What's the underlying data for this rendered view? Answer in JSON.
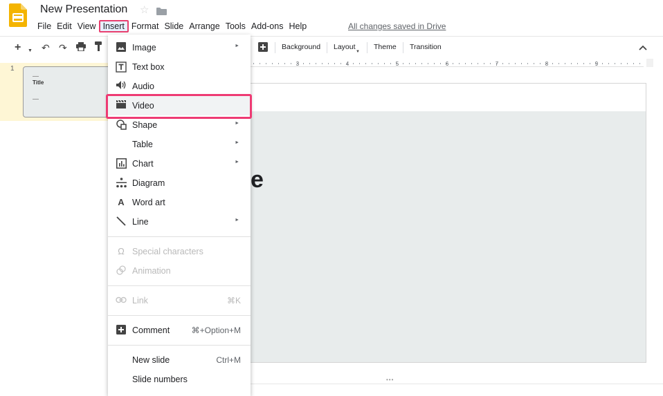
{
  "header": {
    "title": "New Presentation",
    "saved_status": "All changes saved in Drive",
    "accent": "#f4b400"
  },
  "menubar": {
    "items": [
      "File",
      "Edit",
      "View",
      "Insert",
      "Format",
      "Slide",
      "Arrange",
      "Tools",
      "Add-ons",
      "Help"
    ],
    "active": "Insert"
  },
  "toolbar": {
    "background_label": "Background",
    "layout_label": "Layout",
    "theme_label": "Theme",
    "transition_label": "Transition"
  },
  "ruler": {
    "marks": [
      "3",
      "4",
      "5",
      "6",
      "7",
      "8",
      "9"
    ]
  },
  "filmstrip": {
    "slide_number": "1",
    "thumb_title": "Title"
  },
  "canvas": {
    "partial_text": "e"
  },
  "insert_menu": {
    "items": [
      {
        "label": "Image",
        "icon": "image-icon",
        "submenu": true,
        "enabled": true
      },
      {
        "label": "Text box",
        "icon": "text-box-icon",
        "submenu": false,
        "enabled": true
      },
      {
        "label": "Audio",
        "icon": "audio-icon",
        "submenu": false,
        "enabled": true
      },
      {
        "label": "Video",
        "icon": "video-icon",
        "submenu": false,
        "enabled": true,
        "highlighted": true
      },
      {
        "label": "Shape",
        "icon": "shape-icon",
        "submenu": true,
        "enabled": true
      },
      {
        "label": "Table",
        "icon": "",
        "submenu": true,
        "enabled": true
      },
      {
        "label": "Chart",
        "icon": "chart-icon",
        "submenu": true,
        "enabled": true
      },
      {
        "label": "Diagram",
        "icon": "diagram-icon",
        "submenu": false,
        "enabled": true
      },
      {
        "label": "Word art",
        "icon": "word-art-icon",
        "submenu": false,
        "enabled": true
      },
      {
        "label": "Line",
        "icon": "line-icon",
        "submenu": true,
        "enabled": true
      },
      {
        "label": "Special characters",
        "icon": "omega-icon",
        "submenu": false,
        "enabled": false
      },
      {
        "label": "Animation",
        "icon": "animation-icon",
        "submenu": false,
        "enabled": false
      },
      {
        "label": "Link",
        "icon": "link-icon",
        "shortcut": "⌘K",
        "submenu": false,
        "enabled": false
      },
      {
        "label": "Comment",
        "icon": "comment-icon",
        "shortcut": "⌘+Option+M",
        "submenu": false,
        "enabled": true
      },
      {
        "label": "New slide",
        "icon": "",
        "shortcut": "Ctrl+M",
        "submenu": false,
        "enabled": true
      },
      {
        "label": "Slide numbers",
        "icon": "",
        "submenu": false,
        "enabled": true
      }
    ]
  },
  "colors": {
    "highlight_border": "#ee3a73",
    "menu_active_bg": "#e8f0fe",
    "filmstrip_selected": "#fef6d5",
    "slide_bg": "#e8ecec"
  }
}
